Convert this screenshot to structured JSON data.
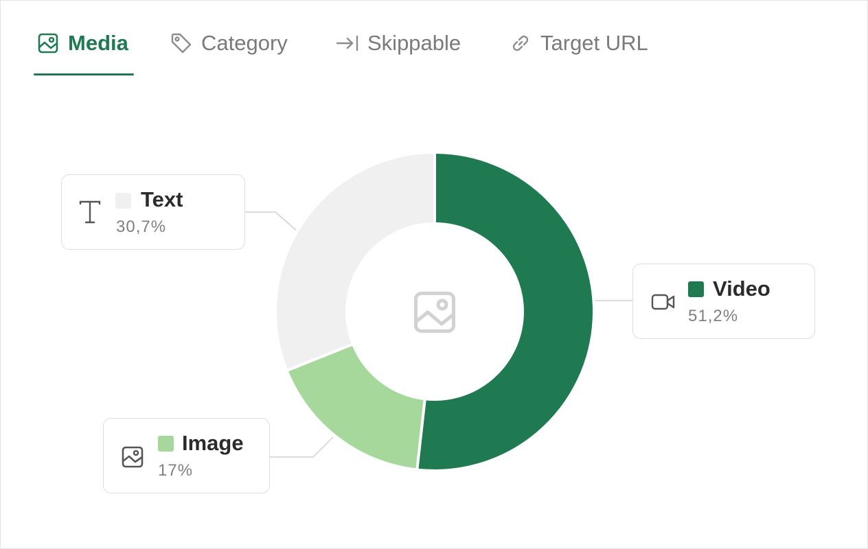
{
  "tabs": [
    {
      "label": "Media",
      "icon": "image-icon",
      "active": true
    },
    {
      "label": "Category",
      "icon": "tag-icon",
      "active": false
    },
    {
      "label": "Skippable",
      "icon": "arrow-bar-right-icon",
      "active": false
    },
    {
      "label": "Target URL",
      "icon": "link-icon",
      "active": false
    }
  ],
  "colors": {
    "accent": "#1f7a52",
    "video": "#1f7a52",
    "image": "#a6d89c",
    "text": "#f0f0f0",
    "center_icon": "#d2d2d2"
  },
  "chart_data": {
    "type": "pie",
    "donut": true,
    "center_icon": "image-icon",
    "slices": [
      {
        "label": "Video",
        "value": 51.2,
        "display": "51,2%",
        "icon": "video-camera-icon",
        "color": "#1f7a52"
      },
      {
        "label": "Image",
        "value": 17,
        "display": "17%",
        "icon": "image-icon",
        "color": "#a6d89c"
      },
      {
        "label": "Text",
        "value": 30.7,
        "display": "30,7%",
        "icon": "text-t-icon",
        "color": "#f0f0f0"
      }
    ]
  }
}
